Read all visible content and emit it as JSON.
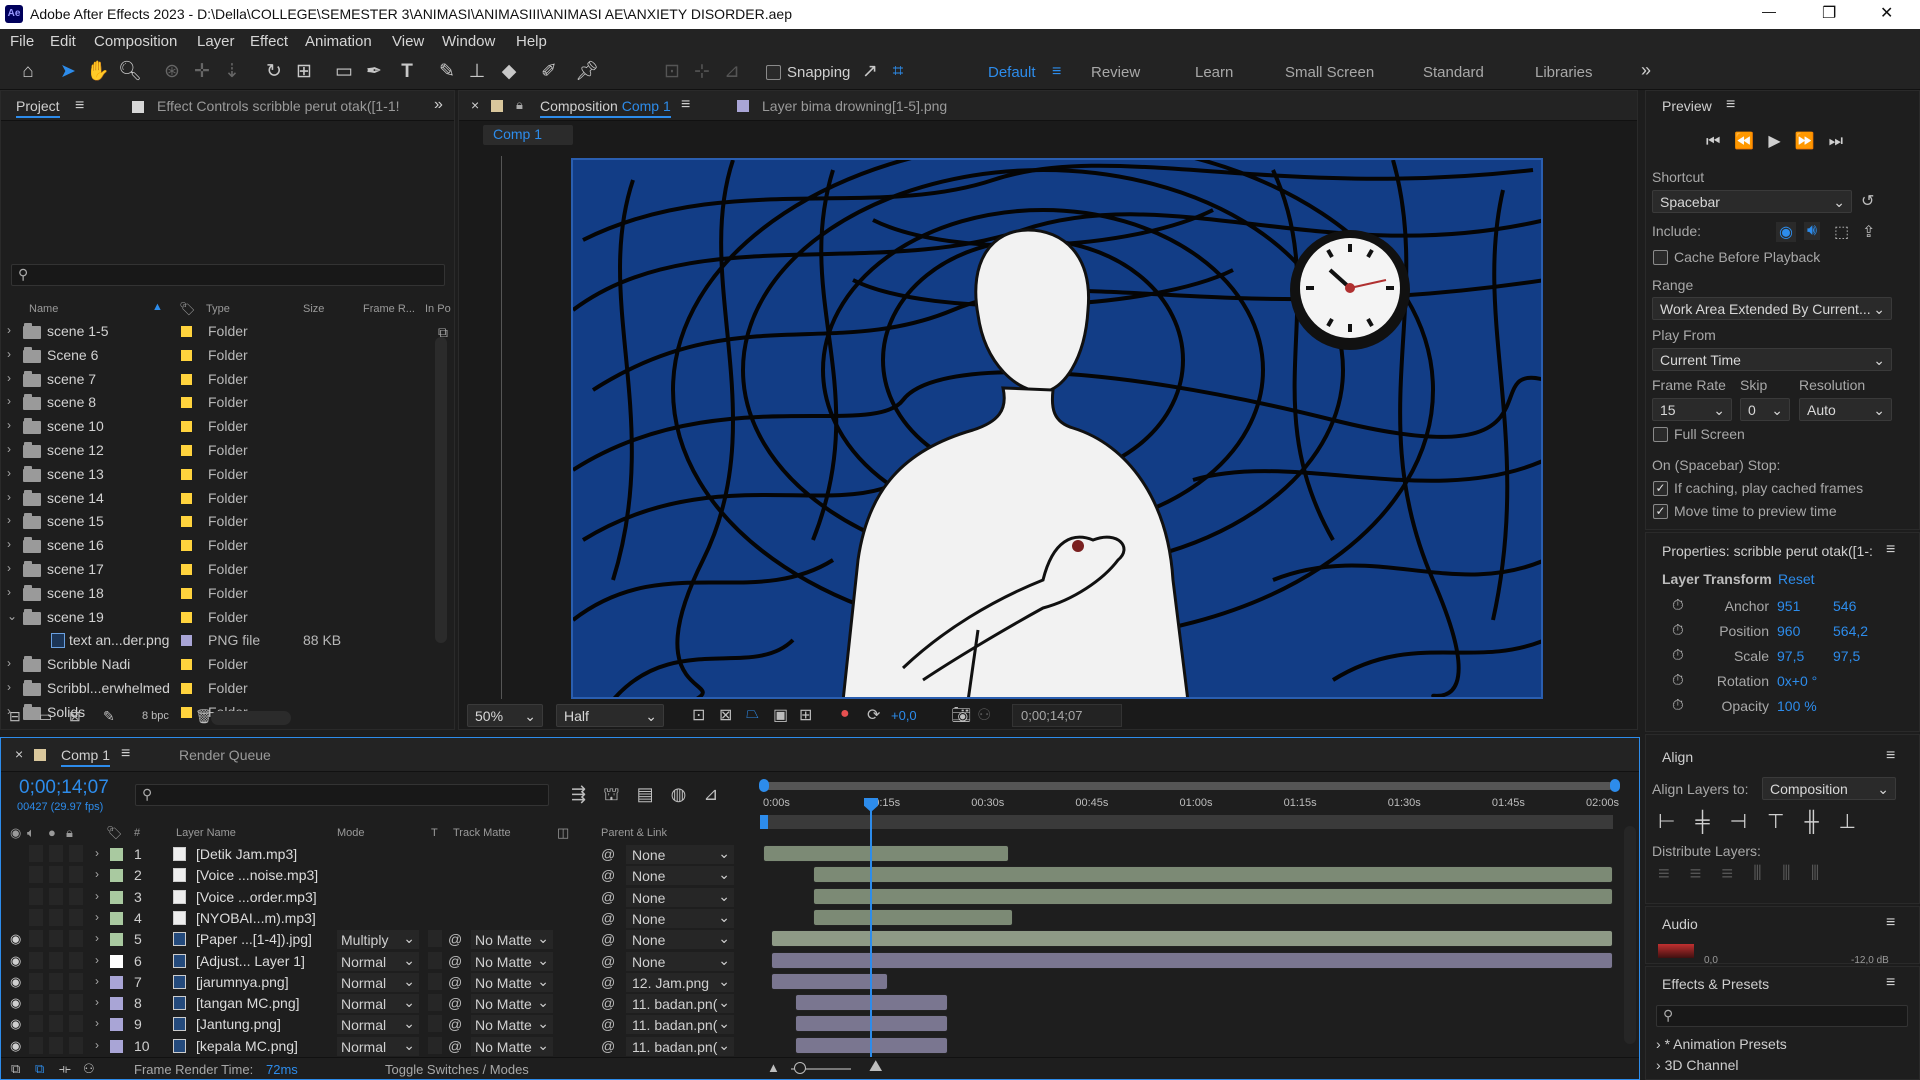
{
  "app": {
    "logo_text": "Ae",
    "window_title": "Adobe After Effects 2023 - D:\\Della\\COLLEGE\\SEMESTER 3\\ANIMASI\\ANIMASIII\\ANIMASI AE\\ANXIETY DISORDER.aep",
    "accent_color": "#2d8ceb"
  },
  "window_controls": {
    "minimize": "—",
    "maximize": "❐",
    "close": "✕"
  },
  "menu": [
    "File",
    "Edit",
    "Composition",
    "Layer",
    "Effect",
    "Animation",
    "View",
    "Window",
    "Help"
  ],
  "toolbar": {
    "snapping_label": "Snapping",
    "workspaces": [
      "Default",
      "Review",
      "Learn",
      "Small Screen",
      "Standard",
      "Libraries"
    ],
    "active_workspace": "Default",
    "more": "»"
  },
  "project_panel": {
    "tab_project": "Project",
    "tab_effect_controls": "Effect Controls scribble perut otak([1-1!",
    "search_placeholder": "",
    "columns": [
      "Name",
      "Type",
      "Size",
      "Frame R...",
      "In Po"
    ],
    "items": [
      {
        "name": "scene 1-5",
        "type": "Folder",
        "size": ""
      },
      {
        "name": "Scene 6",
        "type": "Folder",
        "size": ""
      },
      {
        "name": "scene 7",
        "type": "Folder",
        "size": ""
      },
      {
        "name": "scene 8",
        "type": "Folder",
        "size": ""
      },
      {
        "name": "scene 10",
        "type": "Folder",
        "size": ""
      },
      {
        "name": "scene 12",
        "type": "Folder",
        "size": ""
      },
      {
        "name": "scene 13",
        "type": "Folder",
        "size": ""
      },
      {
        "name": "scene 14",
        "type": "Folder",
        "size": ""
      },
      {
        "name": "scene 15",
        "type": "Folder",
        "size": ""
      },
      {
        "name": "scene 16",
        "type": "Folder",
        "size": ""
      },
      {
        "name": "scene 17",
        "type": "Folder",
        "size": ""
      },
      {
        "name": "scene 18",
        "type": "Folder",
        "size": ""
      },
      {
        "name": "scene 19",
        "type": "Folder",
        "size": ""
      },
      {
        "name": "text an...der.png",
        "type": "PNG file",
        "size": "88 KB"
      },
      {
        "name": "Scribble Nadi",
        "type": "Folder",
        "size": ""
      },
      {
        "name": "Scribbl...erwhelmed",
        "type": "Folder",
        "size": ""
      },
      {
        "name": "Solids",
        "type": "Folder",
        "size": ""
      }
    ],
    "bpc": "8 bpc"
  },
  "composition_panel": {
    "tab_label": "Composition",
    "comp_name": "Comp 1",
    "layer_tab": "Layer  bima drowning[1-5].png",
    "breadcrumb": "Comp 1",
    "zoom": "50%",
    "resolution": "Half",
    "exposure": "+0,0",
    "timecode": "0;00;14;07"
  },
  "preview_panel": {
    "title": "Preview",
    "shortcut_label": "Shortcut",
    "shortcut_value": "Spacebar",
    "include_label": "Include:",
    "cache_label": "Cache Before Playback",
    "range_label": "Range",
    "range_value": "Work Area Extended By Current...",
    "play_from_label": "Play From",
    "play_from_value": "Current Time",
    "frame_rate_label": "Frame Rate",
    "frame_rate_value": "15",
    "skip_label": "Skip",
    "skip_value": "0",
    "resolution_label": "Resolution",
    "resolution_value": "Auto",
    "full_screen_label": "Full Screen",
    "stop_label": "On (Spacebar) Stop:",
    "if_caching_label": "If caching, play cached frames",
    "move_time_label": "Move time to preview time"
  },
  "properties_panel": {
    "title": "Properties: scribble perut otak([1-:",
    "layer_transform": "Layer Transform",
    "reset": "Reset",
    "props": [
      {
        "label": "Anchor",
        "v1": "951",
        "v2": "546"
      },
      {
        "label": "Position",
        "v1": "960",
        "v2": "564,2"
      },
      {
        "label": "Scale",
        "v1": "97,5",
        "v2": "97,5"
      },
      {
        "label": "Rotation",
        "v1": "0x+0 °",
        "v2": ""
      },
      {
        "label": "Opacity",
        "v1": "100 %",
        "v2": ""
      }
    ]
  },
  "align_panel": {
    "title": "Align",
    "align_to_label": "Align Layers to:",
    "align_to_value": "Composition",
    "distribute_label": "Distribute Layers:"
  },
  "audio_panel": {
    "title": "Audio",
    "left_db": "0,0",
    "right_db": "-12,0 dB"
  },
  "effects_panel": {
    "title": "Effects & Presets",
    "items": [
      "* Animation Presets",
      "3D Channel"
    ]
  },
  "timeline": {
    "tab_comp": "Comp 1",
    "tab_render": "Render Queue",
    "timecode": "0;00;14;07",
    "frame_info": "00427 (29.97 fps)",
    "columns": {
      "num": "#",
      "layer_name": "Layer Name",
      "mode": "Mode",
      "t": "T",
      "track_matte": "Track Matte",
      "parent": "Parent & Link"
    },
    "ruler": [
      "0:00s",
      "00:15s",
      "00:30s",
      "00:45s",
      "01:00s",
      "01:15s",
      "01:30s",
      "01:45s",
      "02:00s"
    ],
    "layers": [
      {
        "num": "1",
        "name": "[Detik Jam.mp3]",
        "mode": "",
        "matte": "",
        "parent": "None",
        "color": "#a9c9a0",
        "visible": false,
        "audio": true
      },
      {
        "num": "2",
        "name": "[Voice ...noise.mp3]",
        "mode": "",
        "matte": "",
        "parent": "None",
        "color": "#a9c9a0",
        "visible": false,
        "audio": true
      },
      {
        "num": "3",
        "name": "[Voice ...order.mp3]",
        "mode": "",
        "matte": "",
        "parent": "None",
        "color": "#a9c9a0",
        "visible": false,
        "audio": true
      },
      {
        "num": "4",
        "name": "[NYOBAI...m).mp3]",
        "mode": "",
        "matte": "",
        "parent": "None",
        "color": "#a9c9a0",
        "visible": false,
        "audio": true
      },
      {
        "num": "5",
        "name": "[Paper ...[1-4]).jpg]",
        "mode": "Multiply",
        "matte": "No Matte",
        "parent": "None",
        "color": "#a9c9a0",
        "visible": true,
        "audio": false
      },
      {
        "num": "6",
        "name": "[Adjust... Layer 1]",
        "mode": "Normal",
        "matte": "No Matte",
        "parent": "None",
        "color": "#ffffff",
        "visible": true,
        "audio": false
      },
      {
        "num": "7",
        "name": "[jarumnya.png]",
        "mode": "Normal",
        "matte": "No Matte",
        "parent": "12. Jam.png",
        "color": "#a9a5d6",
        "visible": true,
        "audio": false
      },
      {
        "num": "8",
        "name": "[tangan MC.png]",
        "mode": "Normal",
        "matte": "No Matte",
        "parent": "11. badan.pn(",
        "color": "#a9a5d6",
        "visible": true,
        "audio": false
      },
      {
        "num": "9",
        "name": "[Jantung.png]",
        "mode": "Normal",
        "matte": "No Matte",
        "parent": "11. badan.pn(",
        "color": "#a9a5d6",
        "visible": true,
        "audio": false
      },
      {
        "num": "10",
        "name": "[kepala MC.png]",
        "mode": "Normal",
        "matte": "No Matte",
        "parent": "11. badan.pn(",
        "color": "#a9a5d6",
        "visible": true,
        "audio": false
      }
    ],
    "frame_render_label": "Frame Render Time:",
    "frame_render_value": "72ms",
    "toggle_label": "Toggle Switches / Modes"
  }
}
